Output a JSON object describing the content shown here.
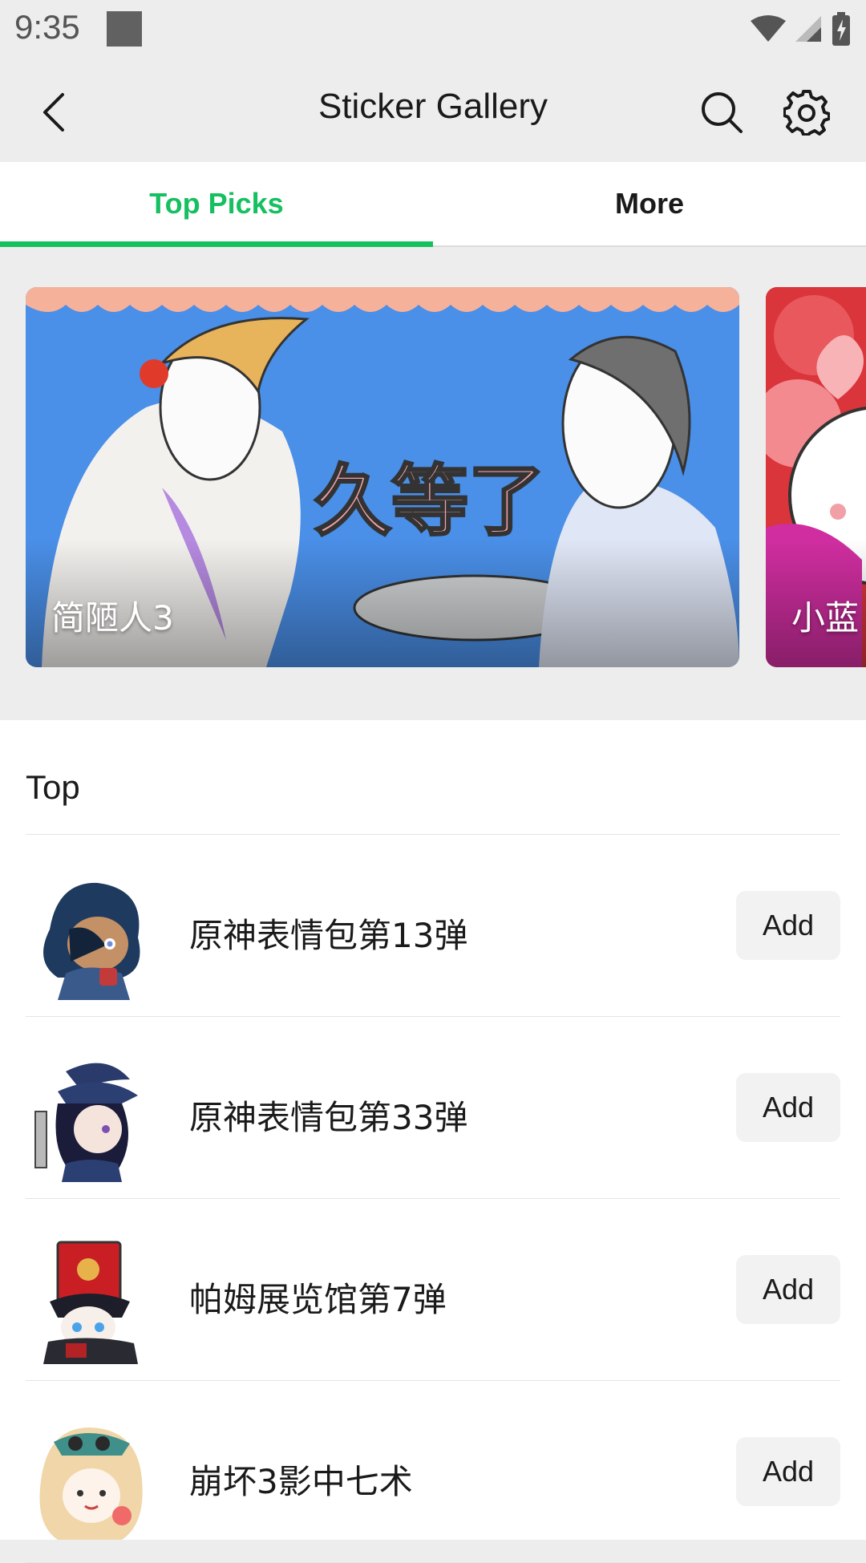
{
  "status": {
    "time": "9:35"
  },
  "appbar": {
    "title": "Sticker Gallery"
  },
  "tabs": [
    {
      "label": "Top Picks",
      "active": true
    },
    {
      "label": "More",
      "active": false
    }
  ],
  "banners": [
    {
      "label": "简陋人3",
      "caption": "久等了"
    },
    {
      "label": "小蓝"
    }
  ],
  "section": {
    "title": "Top"
  },
  "items": [
    {
      "name": "原神表情包第13弹",
      "action": "Add"
    },
    {
      "name": "原神表情包第33弹",
      "action": "Add"
    },
    {
      "name": "帕姆展览馆第7弹",
      "action": "Add"
    },
    {
      "name": "崩坏3影中七术",
      "action": "Add"
    }
  ],
  "colors": {
    "accent": "#16c060",
    "background": "#ededed"
  }
}
